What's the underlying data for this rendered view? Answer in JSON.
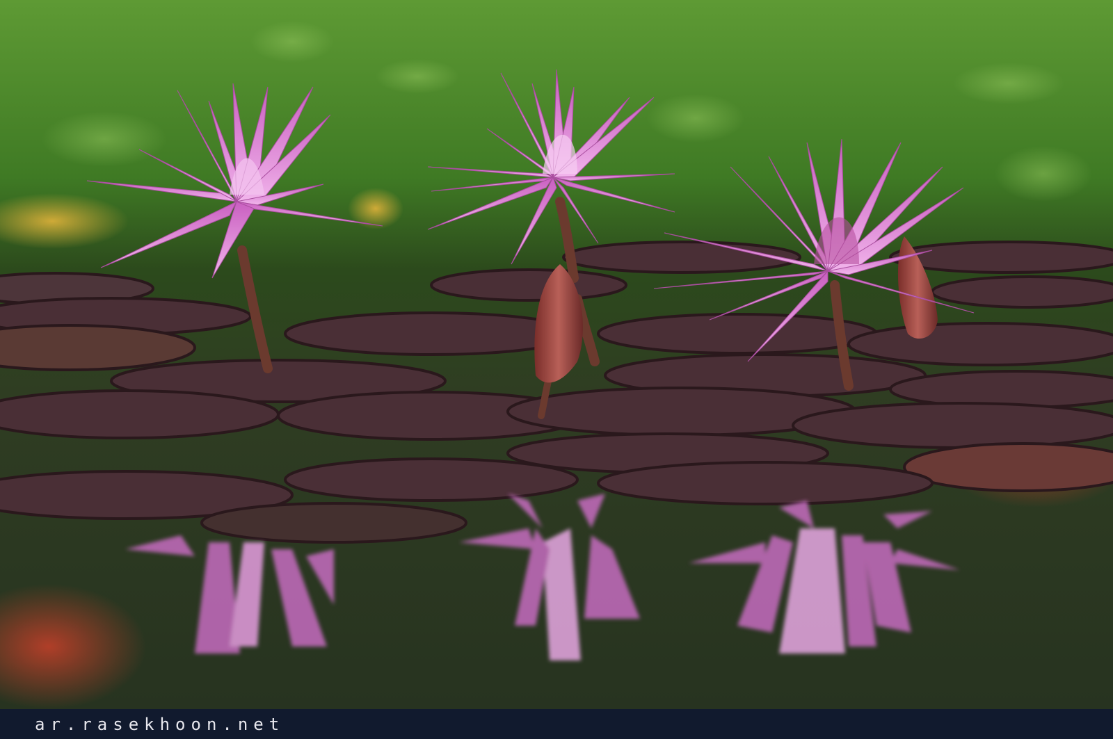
{
  "image": {
    "subject": "three pink water lilies with buds over lily pads, reflected in pond water",
    "colors": {
      "foliage": "#4f8a2c",
      "water": "#2f3d22",
      "lily_pad": "#4a2f36",
      "petal": "#d678c8",
      "petal_light": "#f0b8ea",
      "watermark_bar": "#111a2e"
    }
  },
  "watermark": {
    "text": "ar.rasekhoon.net"
  }
}
